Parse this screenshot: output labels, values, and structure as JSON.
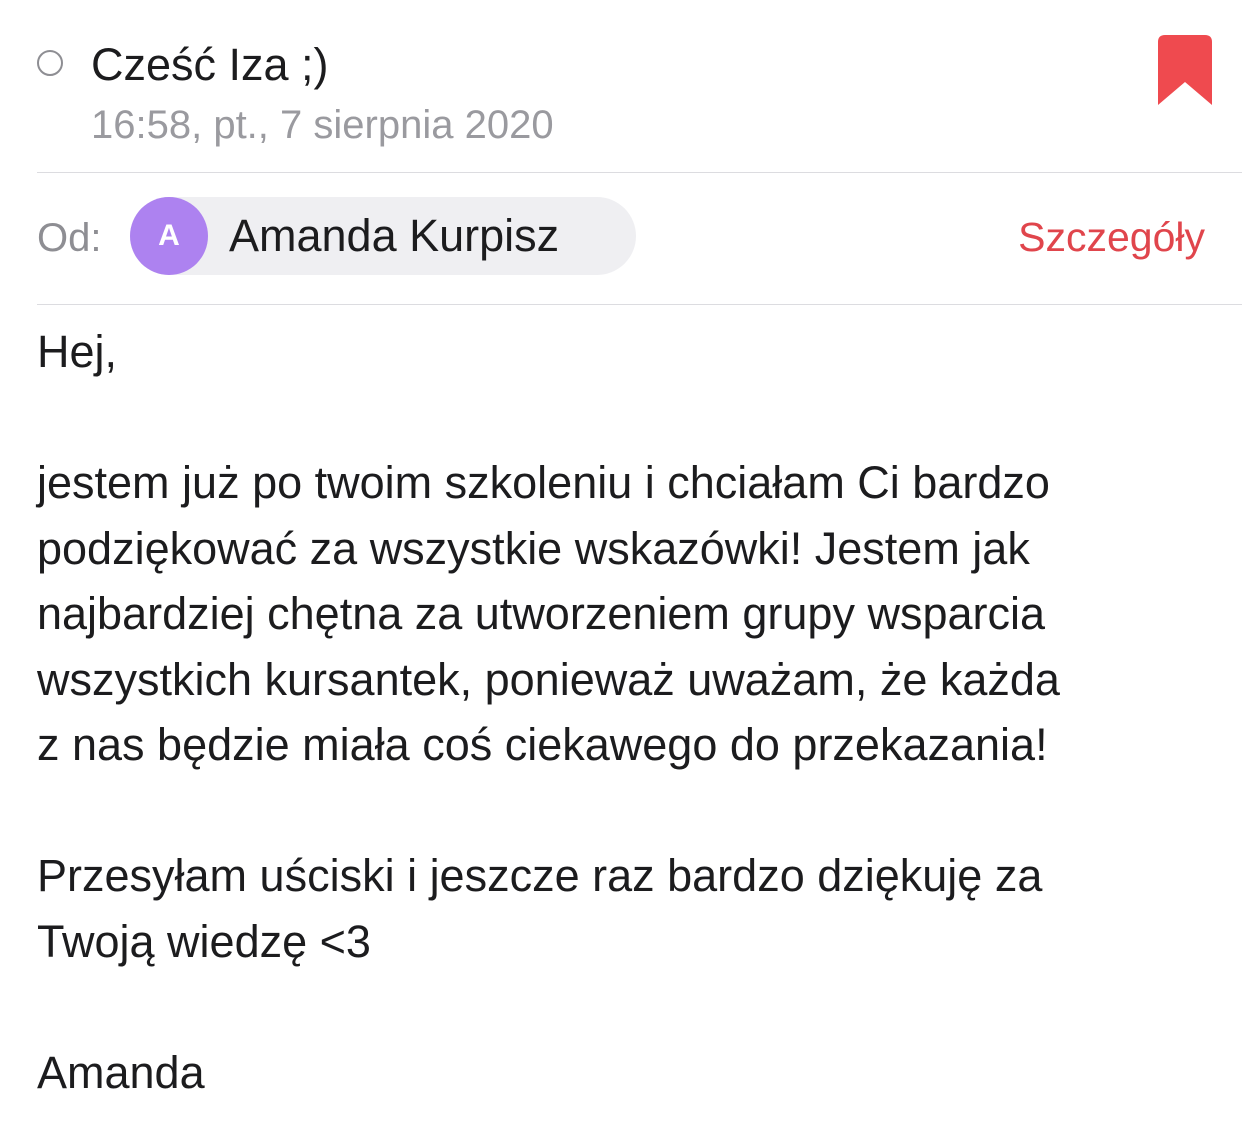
{
  "message": {
    "subject": "Cześć Iza ;)",
    "date": "16:58, pt., 7 sierpnia 2020",
    "from_label": "Od:",
    "sender": {
      "initial": "A",
      "name": "Amanda Kurpisz",
      "avatar_color": "#ad82f0"
    },
    "details_label": "Szczegóły",
    "flag_color": "#ef4a4f",
    "body": {
      "greeting": "Hej,",
      "paragraph1": "jestem już po twoim szkoleniu i chciałam Ci bardzo\npodziękować za wszystkie wskazówki! Jestem jak\nnajbardziej chętna za utworzeniem grupy wsparcia\nwszystkich kursantek, ponieważ uważam, że każda\nz nas będzie miała coś ciekawego do przekazania!",
      "paragraph2": "Przesyłam uściski i jeszcze raz bardzo dziękuję za\nTwoją wiedzę <3",
      "signature": "Amanda"
    }
  },
  "icons": {
    "unread_indicator": "circle-outline-icon",
    "flag": "bookmark-flag-icon"
  },
  "colors": {
    "accent": "#e0454c",
    "secondary_text": "#8e8e93",
    "chip_background": "#efeff2"
  }
}
